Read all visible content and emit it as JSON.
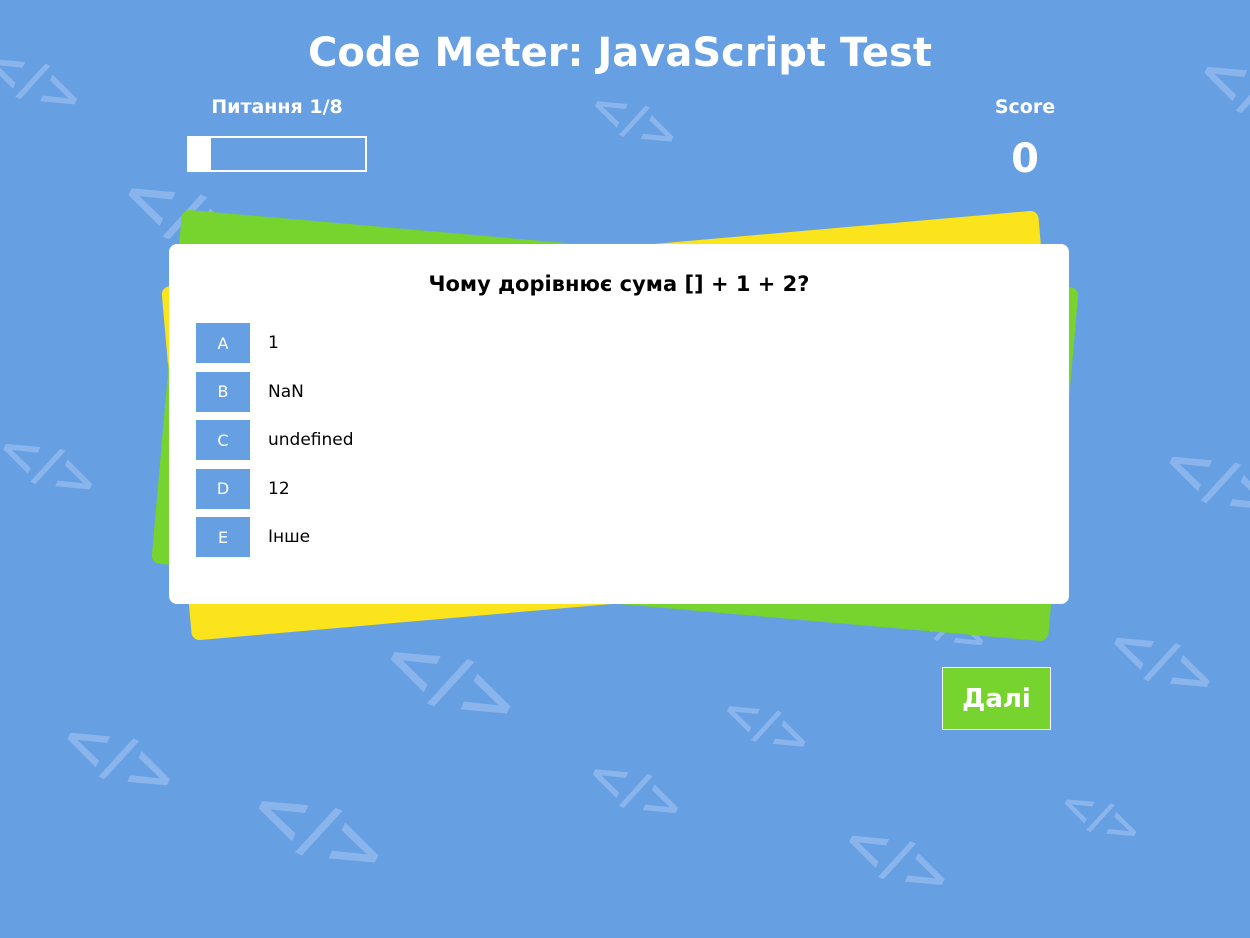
{
  "app": {
    "title": "Code Meter: JavaScript Test"
  },
  "progress": {
    "label": "Питання 1/8",
    "fraction": 0.125
  },
  "score": {
    "label": "Score",
    "value": "0"
  },
  "question": {
    "text": "Чому дорівнює сума [] + 1 + 2?",
    "answers": [
      {
        "letter": "A",
        "text": "1"
      },
      {
        "letter": "B",
        "text": "NaN"
      },
      {
        "letter": "C",
        "text": "undefined"
      },
      {
        "letter": "D",
        "text": "12"
      },
      {
        "letter": "E",
        "text": "Інше"
      }
    ]
  },
  "next_button": {
    "label": "Далі"
  },
  "background_icon": {
    "glyph": "</>",
    "name": "code-brackets-icon"
  },
  "colors": {
    "background": "#679fe3",
    "accent_green": "#77d32d",
    "accent_yellow": "#fbe41b",
    "card": "#ffffff",
    "answer_letter_bg": "#679fe3"
  }
}
